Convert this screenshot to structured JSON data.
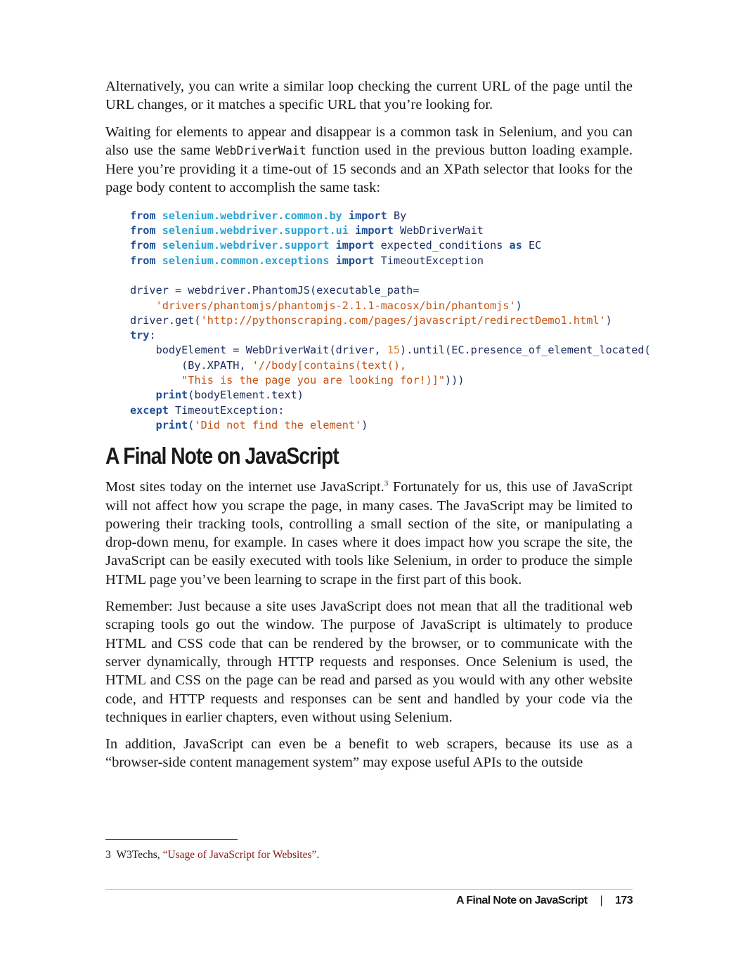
{
  "paragraphs_top": [
    "Alternatively, you can write a similar loop checking the current URL of the page until the URL changes, or it matches a specific URL that you’re looking for."
  ],
  "para_wait": {
    "before": "Waiting for elements to appear and disappear is a common task in Selenium, and you can also use the same ",
    "code": "WebDriverWait",
    "after": " function used in the previous button loading example. Here you’re providing it a time-out of 15 seconds and an XPath selector that looks for the page body content to accomplish the same task:"
  },
  "code_lines": [
    [
      [
        "kw",
        "from"
      ],
      [
        "t",
        " "
      ],
      [
        "mod",
        "selenium.webdriver.common.by"
      ],
      [
        "t",
        " "
      ],
      [
        "kw",
        "import"
      ],
      [
        "t",
        " By"
      ]
    ],
    [
      [
        "kw",
        "from"
      ],
      [
        "t",
        " "
      ],
      [
        "mod",
        "selenium.webdriver.support.ui"
      ],
      [
        "t",
        " "
      ],
      [
        "kw",
        "import"
      ],
      [
        "t",
        " WebDriverWait"
      ]
    ],
    [
      [
        "kw",
        "from"
      ],
      [
        "t",
        " "
      ],
      [
        "mod",
        "selenium.webdriver.support"
      ],
      [
        "t",
        " "
      ],
      [
        "kw",
        "import"
      ],
      [
        "t",
        " expected_conditions "
      ],
      [
        "kw",
        "as"
      ],
      [
        "t",
        " EC"
      ]
    ],
    [
      [
        "kw",
        "from"
      ],
      [
        "t",
        " "
      ],
      [
        "mod",
        "selenium.common.exceptions"
      ],
      [
        "t",
        " "
      ],
      [
        "kw",
        "import"
      ],
      [
        "t",
        " TimeoutException"
      ]
    ],
    [
      [
        "t",
        ""
      ]
    ],
    [
      [
        "t",
        "driver = webdriver.PhantomJS(executable_path="
      ]
    ],
    [
      [
        "t",
        "    "
      ],
      [
        "str",
        "'drivers/phantomjs/phantomjs-2.1.1-macosx/bin/phantomjs'"
      ],
      [
        "t",
        ")"
      ]
    ],
    [
      [
        "t",
        "driver.get("
      ],
      [
        "str",
        "'http://pythonscraping.com/pages/javascript/redirectDemo1.html'"
      ],
      [
        "t",
        ")"
      ]
    ],
    [
      [
        "kw",
        "try"
      ],
      [
        "t",
        ":"
      ]
    ],
    [
      [
        "t",
        "    bodyElement = WebDriverWait(driver, "
      ],
      [
        "num",
        "15"
      ],
      [
        "t",
        ").until(EC.presence_of_element_located("
      ]
    ],
    [
      [
        "t",
        "        (By.XPATH, "
      ],
      [
        "str",
        "'//body[contains(text(),"
      ]
    ],
    [
      [
        "t",
        "        "
      ],
      [
        "str",
        "\"This is the page you are looking for!)]\""
      ],
      [
        "t",
        ")))"
      ]
    ],
    [
      [
        "t",
        "    "
      ],
      [
        "kw",
        "print"
      ],
      [
        "t",
        "(bodyElement.text)"
      ]
    ],
    [
      [
        "kw",
        "except"
      ],
      [
        "t",
        " TimeoutException:"
      ]
    ],
    [
      [
        "t",
        "    "
      ],
      [
        "kw",
        "print"
      ],
      [
        "t",
        "("
      ],
      [
        "str",
        "'Did not find the element'"
      ],
      [
        "t",
        ")"
      ]
    ]
  ],
  "heading": "A Final Note on JavaScript",
  "para_intro": {
    "before": "Most sites today on the internet use JavaScript.",
    "fnref": "3",
    "after": " Fortunately for us, this use of Java­Script will not affect how you scrape the page, in many cases. The JavaScript may be limited to powering their tracking tools, controlling a small section of the site, or manipulating a drop-down menu, for example. In cases where it does impact how you scrape the site, the JavaScript can be easily executed with tools like Selenium, in order to produce the simple HTML page you’ve been learning to scrape in the first part of this book."
  },
  "para_remember": "Remember: Just because a site uses JavaScript does not mean that all the traditional web scraping tools go out the window. The purpose of JavaScript is ultimately to pro­duce HTML and CSS code that can be rendered by the browser, or to communicate with the server dynamically, through HTTP requests and responses. Once Selenium is used, the HTML and CSS on the page can be read and parsed as you would with any other website code, and HTTP requests and responses can be sent and handled by your code via the techniques in earlier chapters, even without using Selenium.",
  "para_addition": "In addition, JavaScript can even be a benefit to web scrapers, because its use as a “browser-side content management system” may expose useful APIs to the outside",
  "footnote": {
    "number": "3",
    "prefix": "W3Techs, ",
    "link": "“Usage of JavaScript for Websites”",
    "suffix": "."
  },
  "running_footer": {
    "section": "A Final Note on JavaScript",
    "separator": "|",
    "page_number": "173"
  }
}
